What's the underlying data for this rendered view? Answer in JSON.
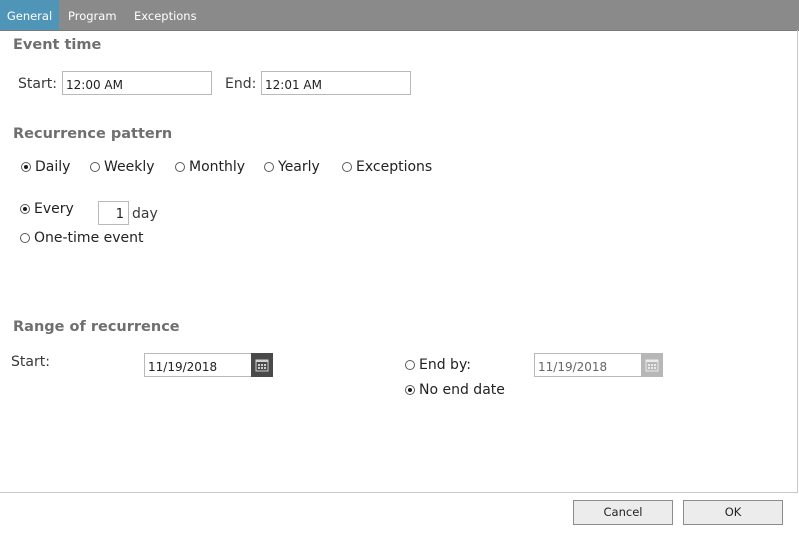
{
  "tabs": [
    {
      "label": "General",
      "active": true
    },
    {
      "label": "Program",
      "active": false
    },
    {
      "label": "Exceptions",
      "active": false
    }
  ],
  "event_time": {
    "title": "Event time",
    "start_label": "Start:",
    "start_value": "12:00 AM",
    "end_label": "End:",
    "end_value": "12:01 AM"
  },
  "recurrence_pattern": {
    "title": "Recurrence pattern",
    "options": [
      {
        "label": "Daily",
        "selected": true
      },
      {
        "label": "Weekly",
        "selected": false
      },
      {
        "label": "Monthly",
        "selected": false
      },
      {
        "label": "Yearly",
        "selected": false
      },
      {
        "label": "Exceptions",
        "selected": false
      }
    ],
    "every_label": "Every",
    "every_selected": true,
    "every_value": "1",
    "every_unit": "day",
    "one_time_label": "One-time event",
    "one_time_selected": false
  },
  "range": {
    "title": "Range of recurrence",
    "start_label": "Start:",
    "start_value": "11/19/2018",
    "end_by_label": "End by:",
    "end_by_selected": false,
    "end_by_value": "11/19/2018",
    "no_end_label": "No end date",
    "no_end_selected": true
  },
  "footer": {
    "cancel_label": "Cancel",
    "ok_label": "OK"
  },
  "colors": {
    "tabbar": "#8a8a8a",
    "active_tab": "#4f95b8",
    "section_title": "#6f6f6f"
  }
}
